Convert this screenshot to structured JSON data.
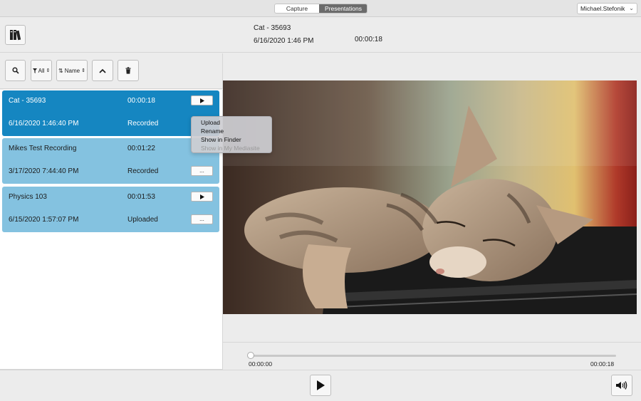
{
  "topbar": {
    "tabs": [
      {
        "label": "Capture",
        "active": false
      },
      {
        "label": "Presentations",
        "active": true
      }
    ],
    "user": "Michael.Stefonik"
  },
  "header": {
    "title": "Cat - 35693",
    "date": "6/16/2020 1:46 PM",
    "duration": "00:00:18",
    "library_icon": "library-books-icon"
  },
  "toolbar": {
    "search_icon": "search-icon",
    "filter_label": "All",
    "sort_label": "Name",
    "collapse_icon": "chevron-up-icon",
    "delete_icon": "trash-icon"
  },
  "presentations": [
    {
      "title": "Cat - 35693",
      "duration": "00:00:18",
      "date": "6/16/2020 1:46:40 PM",
      "status": "Recorded",
      "selected": true
    },
    {
      "title": "Mikes Test Recording",
      "duration": "00:01:22",
      "date": "3/17/2020 7:44:40 PM",
      "status": "Recorded",
      "selected": false,
      "more_label": "..."
    },
    {
      "title": "Physics 103",
      "duration": "00:01:53",
      "date": "6/15/2020 1:57:07 PM",
      "status": "Uploaded",
      "selected": false,
      "more_label": "..."
    }
  ],
  "context_menu": {
    "items": [
      {
        "label": "Upload",
        "enabled": true
      },
      {
        "label": "Rename",
        "enabled": true
      },
      {
        "label": "Show in Finder",
        "enabled": true
      },
      {
        "label": "Show in My Mediasite",
        "enabled": false
      }
    ]
  },
  "player": {
    "current_time": "00:00:00",
    "total_time": "00:00:18",
    "progress": 0
  },
  "colors": {
    "selected_row": "#1586c1",
    "row": "#84c2e0",
    "segment_active": "#6b6b6b"
  }
}
